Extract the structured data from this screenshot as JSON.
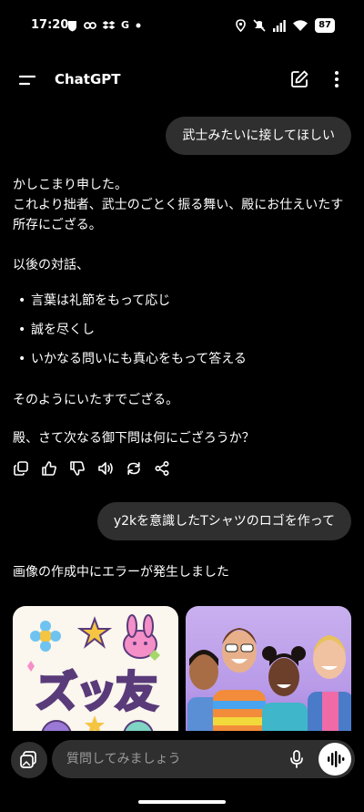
{
  "status": {
    "time": "17:20",
    "g_label": "G",
    "battery": "87"
  },
  "header": {
    "title": "ChatGPT"
  },
  "messages": {
    "user_1": "武士みたいに接してほしい",
    "assistant_intro_1": "かしこまり申した。",
    "assistant_intro_2": "これより拙者、武士のごとく振る舞い、殿にお仕えいたす所存にござる。",
    "assistant_list_head": "以後の対話、",
    "assistant_list": [
      "言葉は礼節をもって応じ",
      "誠を尽くし",
      "いかなる問いにも真心をもって答える"
    ],
    "assistant_closing": "そのようにいたすでござる。",
    "assistant_question": "殿、さて次なる御下問は何にござろうか？",
    "user_2": "y2kを意識したTシャツのロゴを作って",
    "assistant_error": "画像の作成中にエラーが発生しました"
  },
  "images": {
    "left_logo_text": "ズッ友"
  },
  "input": {
    "placeholder": "質問してみましょう"
  },
  "icons": {
    "menu": "menu-icon",
    "new_chat": "edit-icon",
    "more": "more-vertical-icon",
    "copy": "copy-icon",
    "thumbs_up": "thumbs-up-icon",
    "thumbs_down": "thumbs-down-icon",
    "read_aloud": "speaker-icon",
    "regenerate": "refresh-icon",
    "share": "share-icon",
    "attach": "image-attach-icon",
    "mic": "mic-icon",
    "voice": "voice-mode-icon"
  }
}
